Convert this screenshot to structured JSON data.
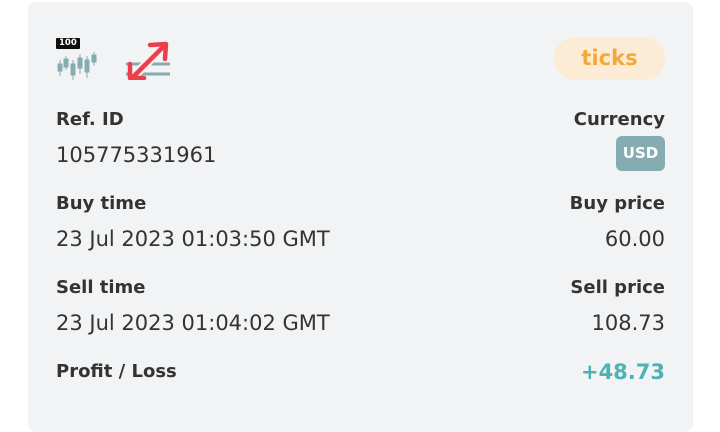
{
  "header": {
    "asset_badge": "100",
    "asset_icon": "volatility-100-candles-icon",
    "trade_type_icon": "rise-fall-arrows-icon",
    "duration_pill": "ticks"
  },
  "details": {
    "ref_id_label": "Ref. ID",
    "ref_id_value": "105775331961",
    "currency_label": "Currency",
    "currency_value": "USD",
    "buy_time_label": "Buy time",
    "buy_time_value": "23 Jul 2023 01:03:50 GMT",
    "buy_price_label": "Buy price",
    "buy_price_value": "60.00",
    "sell_time_label": "Sell time",
    "sell_time_value": "23 Jul 2023 01:04:02 GMT",
    "sell_price_label": "Sell price",
    "sell_price_value": "108.73",
    "profit_loss_label": "Profit / Loss",
    "profit_loss_value": "+48.73"
  },
  "colors": {
    "card_bg": "#f2f3f4",
    "ticks_pill_bg": "#fcebd5",
    "ticks_pill_text": "#f2a93b",
    "usd_badge_bg": "#85acb0",
    "profit_text": "#4bb4b3",
    "rise_arrow": "#ec3f4b",
    "candle": "#85acb0"
  }
}
